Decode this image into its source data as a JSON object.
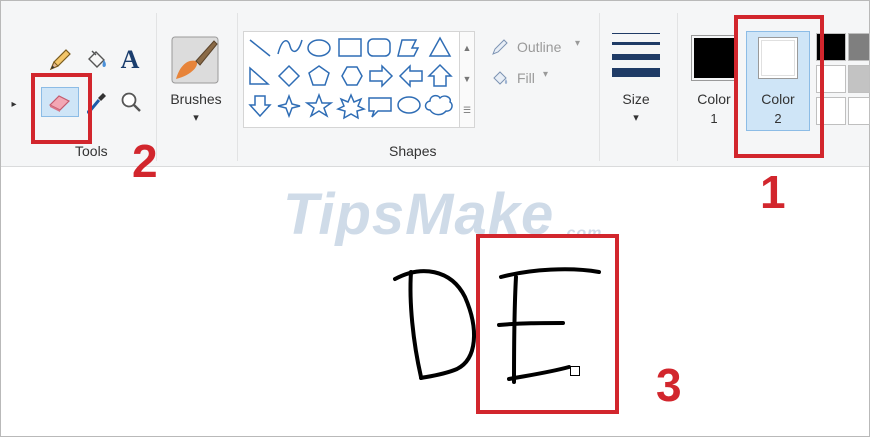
{
  "ribbon": {
    "tools_group_label": "Tools",
    "shapes_group_label": "Shapes",
    "brushes_label": "Brushes",
    "outline_label": "Outline",
    "fill_label": "Fill",
    "size_label": "Size",
    "color1_label": "Color",
    "color1_num": "1",
    "color2_label": "Color",
    "color2_num": "2",
    "text_tool_glyph": "A",
    "chevron_glyph": "▾",
    "small_arrow_glyph": "▸"
  },
  "annotations": {
    "step1": "1",
    "step2": "2",
    "step3": "3"
  },
  "watermark": {
    "brand": "TipsMake",
    "suffix": ".com"
  },
  "colors": {
    "accent_red": "#d2262d",
    "selected_bg": "#cfe5f7",
    "selected_border": "#8cbce6",
    "color1": "#000000",
    "color2": "#ffffff"
  }
}
